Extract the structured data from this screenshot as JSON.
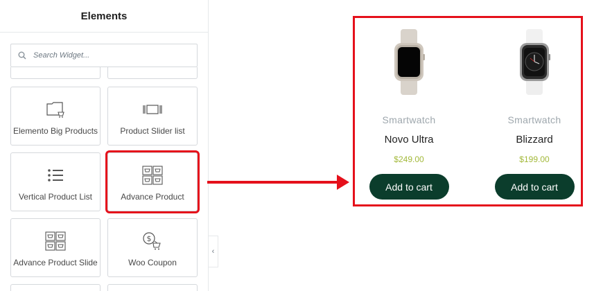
{
  "panel": {
    "title": "Elements",
    "search_placeholder": "Search Widget..."
  },
  "widgets": [
    {
      "label": "Elemento Big Products",
      "icon": "big-products-icon"
    },
    {
      "label": "Product Slider list",
      "icon": "product-slider-icon"
    },
    {
      "label": "Vertical Product List",
      "icon": "vertical-list-icon"
    },
    {
      "label": "Advance Product",
      "icon": "advance-product-icon"
    },
    {
      "label": "Advance Product Slide",
      "icon": "advance-product-slide-icon"
    },
    {
      "label": "Woo Coupon",
      "icon": "coupon-icon"
    }
  ],
  "collapse_glyph": "‹",
  "products": [
    {
      "category": "Smartwatch",
      "name": "Novo Ultra",
      "price": "$249.00",
      "button": "Add to cart"
    },
    {
      "category": "Smartwatch",
      "name": "Blizzard",
      "price": "$199.00",
      "button": "Add to cart"
    }
  ],
  "colors": {
    "highlight": "#e5101b",
    "button_bg": "#0b3d2c",
    "price": "#a3b93a",
    "category": "#9ea7ad"
  }
}
